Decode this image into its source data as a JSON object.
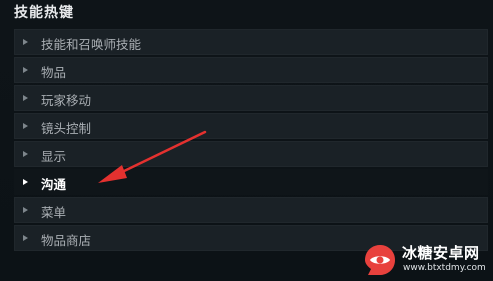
{
  "section": {
    "title": "技能热键"
  },
  "menu": {
    "items": [
      {
        "label": "技能和召唤师技能",
        "active": false
      },
      {
        "label": "物品",
        "active": false
      },
      {
        "label": "玩家移动",
        "active": false
      },
      {
        "label": "镜头控制",
        "active": false
      },
      {
        "label": "显示",
        "active": false
      },
      {
        "label": "沟通",
        "active": true
      },
      {
        "label": "菜单",
        "active": false
      },
      {
        "label": "物品商店",
        "active": false
      }
    ]
  },
  "annotation": {
    "arrow_icon": "red-arrow-icon",
    "arrow_color": "#e4312f"
  },
  "watermark": {
    "title": "冰糖安卓网",
    "url": "www.btxtdmy.com",
    "logo_icon": "watermark-logo-icon",
    "logo_color": "#e8413d"
  },
  "colors": {
    "background": "#0f1419",
    "row_bg": "#1a2126",
    "row_text": "#a9aeb3",
    "active_text": "#ffffff"
  }
}
